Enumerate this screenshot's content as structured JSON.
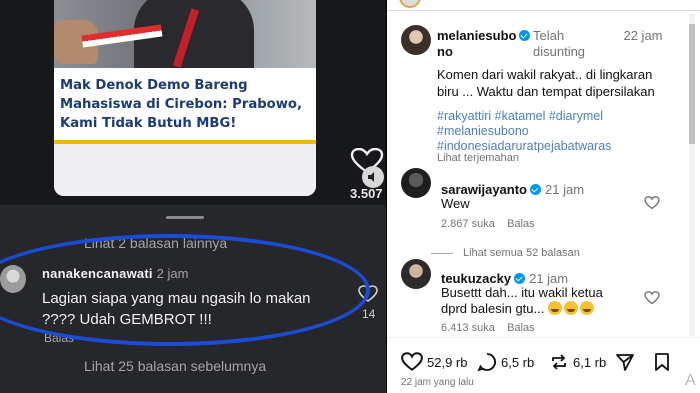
{
  "left": {
    "headline": [
      "Mak Denok Demo Bareng",
      "Mahasiswa di Cirebon: Prabowo,",
      "Kami Tidak Butuh MBG!"
    ],
    "video_like_count": "3.507",
    "more_replies_top": "Lihat 2 balasan lainnya",
    "comment": {
      "username": "nanakencanawati",
      "time": "2 jam",
      "text": "Lagian siapa yang mau ngasih lo makan ???? Udah GEMBROT !!!",
      "reply_label": "Balas",
      "like_count": "14"
    },
    "more_replies_bottom": "Lihat 25 balasan sebelumnya"
  },
  "right": {
    "post": {
      "username_line1": "melaniesubo",
      "username_line2": "no",
      "edited_label": "Telah disunting",
      "time": "22 jam",
      "caption": "Komen dari wakil rakyat.. di lingkaran biru ... Waktu dan tempat dipersilakan",
      "hashtags": [
        "#rakyattiri #katamel #diarymel",
        "#melaniesubono",
        "#indonesiadaruratpejabatwaras"
      ],
      "see_translation": "Lihat terjemahan"
    },
    "comments": [
      {
        "username": "sarawijayanto",
        "time": "21 jam",
        "text": "Wew",
        "likes": "2.867 suka",
        "reply_label": "Balas",
        "view_replies": "Lihat semua 52 balasan"
      },
      {
        "username": "teukuzacky",
        "time": "21 jam",
        "text": "Busettt dah... itu wakil ketua dprd balesin gtu...",
        "likes": "6.413 suka",
        "reply_label": "Balas"
      }
    ],
    "actions": {
      "likes": "52,9 rb",
      "comments": "6,5 rb",
      "reposts": "6,1 rb"
    },
    "posted_ago": "22 jam yang lalu"
  },
  "colors": {
    "annotation_circle": "#1b4cd6",
    "verified_badge": "#0095f6",
    "hashtag": "#4e7fbf"
  }
}
